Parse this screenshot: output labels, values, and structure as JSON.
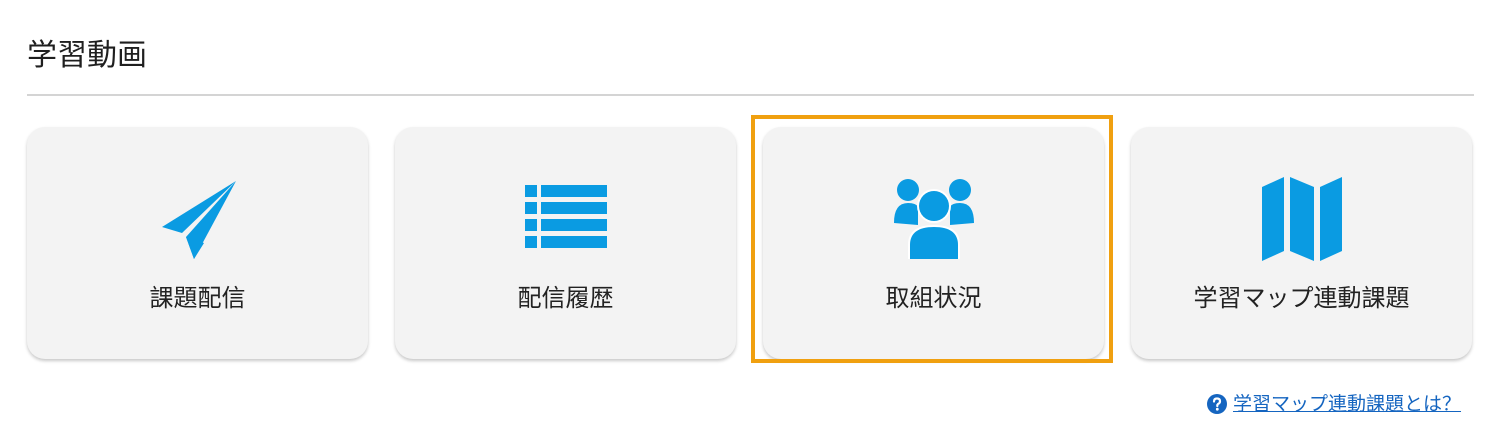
{
  "header": {
    "title": "学習動画"
  },
  "colors": {
    "icon_blue": "#0a9be2",
    "card_background": "#f3f3f3",
    "highlight_border": "#f0a010",
    "link_blue": "#1565c0"
  },
  "cards": [
    {
      "label": "課題配信",
      "icon": "paper-plane-icon"
    },
    {
      "label": "配信履歴",
      "icon": "list-icon"
    },
    {
      "label": "取組状況",
      "icon": "users-icon"
    },
    {
      "label": "学習マップ連動課題",
      "icon": "map-icon"
    }
  ],
  "help": {
    "link_text": "学習マップ連動課題とは？",
    "icon": "question-circle-icon"
  }
}
